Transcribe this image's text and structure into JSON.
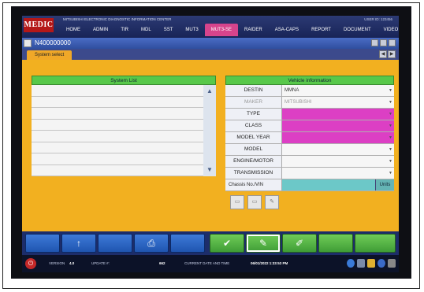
{
  "app": {
    "logo": "MEDIC",
    "brand": "MITSUBISHI ELECTRONIC DIAGNOSTIC INFORMATION CENTER",
    "user_info": "USER ID:  123456"
  },
  "menu": {
    "items": [
      "HOME",
      "ADMIN",
      "TIR",
      "MDL",
      "SST",
      "MUT3",
      "MUT3-SE",
      "RAIDER",
      "ASA-CAPS",
      "REPORT",
      "DOCUMENT",
      "VIDEO"
    ],
    "active": "MUT3-SE"
  },
  "window": {
    "title": "N400000000"
  },
  "tab": {
    "label": "System select"
  },
  "system_list": {
    "header": "System List",
    "rows": 8
  },
  "vehicle_info": {
    "header": "Vehicle information",
    "rows": [
      {
        "label": "DESTIN",
        "value": "MMNA",
        "style": "normal"
      },
      {
        "label": "MAKER",
        "value": "MITSUBISHI",
        "style": "dim"
      },
      {
        "label": "TYPE",
        "value": "",
        "style": "pink"
      },
      {
        "label": "CLASS",
        "value": "",
        "style": "pink"
      },
      {
        "label": "MODEL YEAR",
        "value": "",
        "style": "pink"
      },
      {
        "label": "MODEL",
        "value": "",
        "style": "normal"
      },
      {
        "label": "ENGINE/MOTOR",
        "value": "",
        "style": "normal"
      },
      {
        "label": "TRANSMISSION",
        "value": "",
        "style": "normal"
      }
    ],
    "chassis_label": "Chassis No./VIN",
    "units_label": "Units"
  },
  "bottom_buttons": [
    "",
    "↑",
    "",
    "⎙",
    "",
    "✔",
    "✎",
    "✐",
    "",
    ""
  ],
  "status": {
    "version_label": "VERSION",
    "version": "4.0",
    "update_label": "UPDATE #:",
    "update": "662",
    "datetime_label": "CURRENT DATE AND TIME",
    "datetime": "06/01/2022 1:33:53 PM"
  },
  "colors": {
    "header_green": "#58c84a",
    "content_yellow": "#f2b020",
    "required_pink": "#dc3fc4",
    "arrow_red": "#e02020"
  }
}
